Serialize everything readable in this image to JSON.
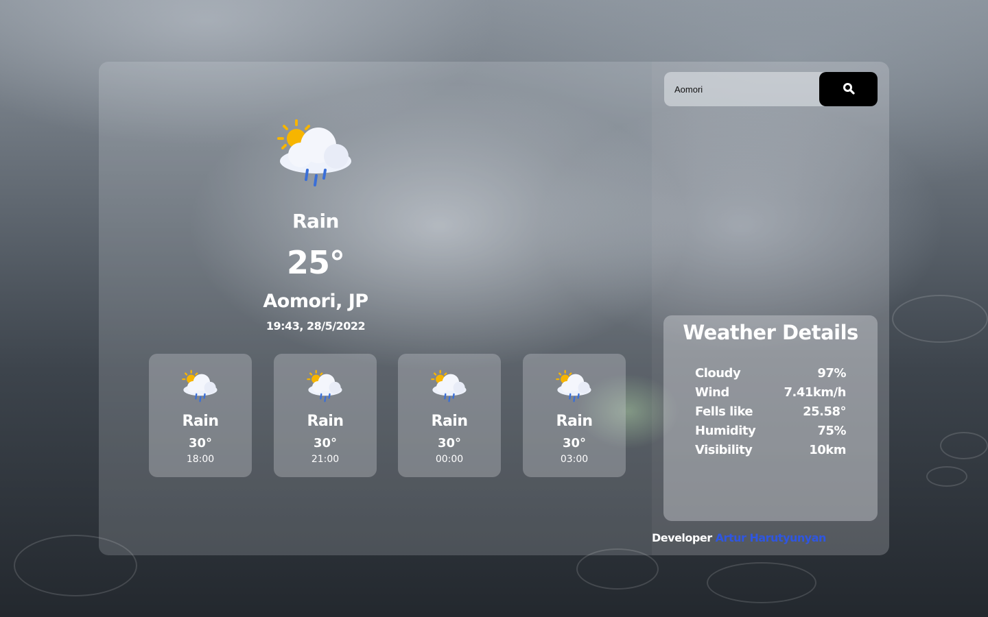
{
  "search": {
    "value": "Aomori",
    "icon": "search-icon"
  },
  "current": {
    "icon": "sun-cloud-rain-icon",
    "condition": "Rain",
    "temperature": "25°",
    "location": "Aomori, JP",
    "datetime": "19:43, 28/5/2022"
  },
  "forecast": [
    {
      "icon": "sun-cloud-rain-icon",
      "condition": "Rain",
      "temperature": "30°",
      "time": "18:00"
    },
    {
      "icon": "sun-cloud-rain-icon",
      "condition": "Rain",
      "temperature": "30°",
      "time": "21:00"
    },
    {
      "icon": "sun-cloud-rain-icon",
      "condition": "Rain",
      "temperature": "30°",
      "time": "00:00"
    },
    {
      "icon": "sun-cloud-rain-icon",
      "condition": "Rain",
      "temperature": "30°",
      "time": "03:00"
    }
  ],
  "details": {
    "title": "Weather Details",
    "rows": [
      {
        "label": "Cloudy",
        "value": "97%"
      },
      {
        "label": "Wind",
        "value": "7.41km/h"
      },
      {
        "label": "Fells like",
        "value": "25.58°"
      },
      {
        "label": "Humidity",
        "value": "75%"
      },
      {
        "label": "Visibility",
        "value": "10km"
      }
    ]
  },
  "footer": {
    "prefix": "Developer",
    "author": "Artur Harutyunyan"
  },
  "colors": {
    "link": "#2f56e0",
    "search_button": "#000000",
    "sun": "#f7b500",
    "rain": "#3a6fd8"
  }
}
